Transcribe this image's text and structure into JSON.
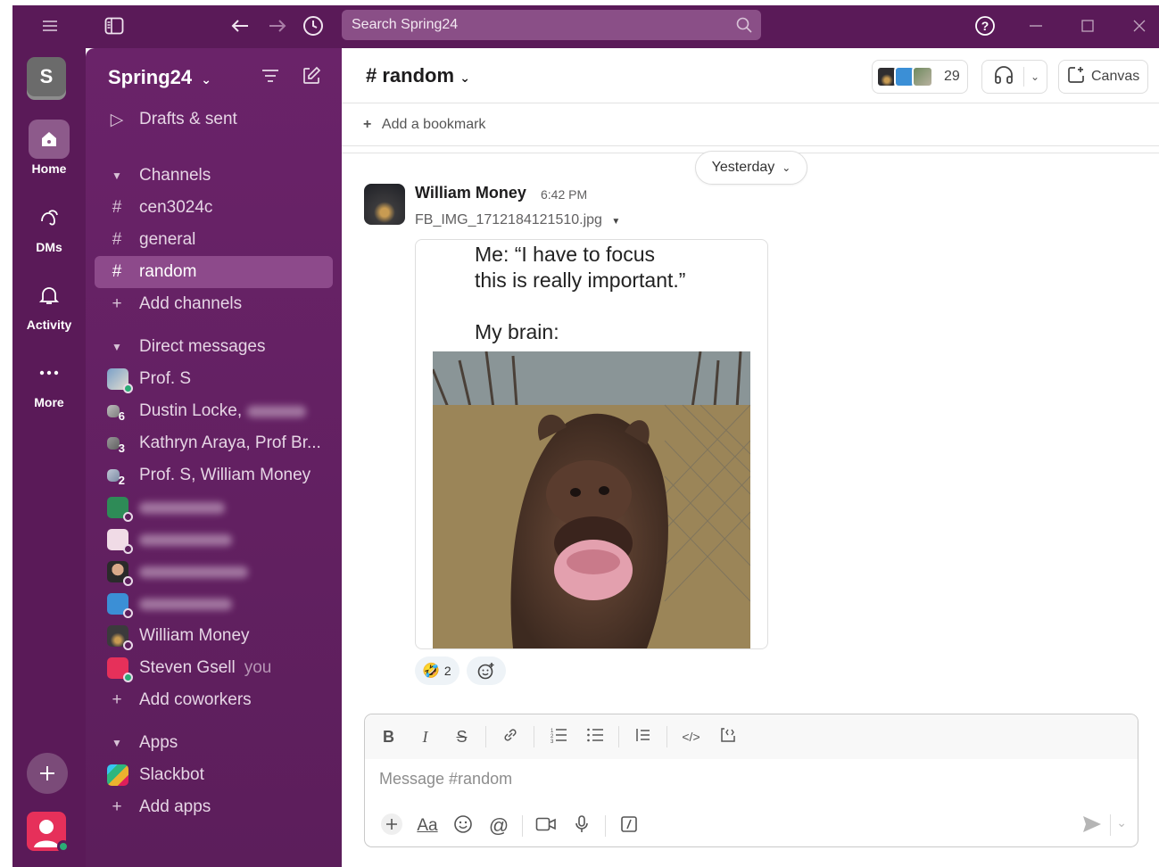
{
  "titlebar": {
    "search_placeholder": "Search Spring24"
  },
  "rail": {
    "workspace_initial": "S",
    "items": [
      {
        "label": "Home"
      },
      {
        "label": "DMs"
      },
      {
        "label": "Activity"
      },
      {
        "label": "More"
      }
    ]
  },
  "sidebar": {
    "workspace_name": "Spring24",
    "drafts_label": "Drafts & sent",
    "channels_header": "Channels",
    "channels": [
      "cen3024c",
      "general",
      "random"
    ],
    "add_channels": "Add channels",
    "dms_header": "Direct messages",
    "dms": [
      {
        "name": "Prof. S",
        "count": ""
      },
      {
        "name": "Dustin Locke,",
        "count": "6"
      },
      {
        "name": "Kathryn Araya, Prof Br...",
        "count": "3"
      },
      {
        "name": "Prof. S, William Money",
        "count": "2"
      },
      {
        "name": "William Money",
        "count": ""
      },
      {
        "name": "Steven Gsell",
        "count": "",
        "you": "you"
      }
    ],
    "add_coworkers": "Add coworkers",
    "apps_header": "Apps",
    "apps": [
      "Slackbot"
    ],
    "add_apps": "Add apps"
  },
  "channel": {
    "hash": "#",
    "name": "random",
    "member_count": "29",
    "canvas_label": "Canvas",
    "bookmark_label": "Add a bookmark"
  },
  "messages": {
    "day_divider": "Yesterday",
    "author": "William Money",
    "time": "6:42 PM",
    "file_name": "FB_IMG_1712184121510.jpg",
    "meme_lines": [
      "Me: “I have to focus",
      "this is really important.”",
      "My brain:"
    ],
    "reaction_emoji": "🤣",
    "reaction_count": "2"
  },
  "composer": {
    "placeholder": "Message #random",
    "format_buttons": [
      "bold",
      "italic",
      "strikethrough",
      "link",
      "ordered-list",
      "bulleted-list",
      "blockquote",
      "code",
      "code-block"
    ]
  },
  "colors": {
    "aubergine": "#5a1a58",
    "sidebar": "#6a2369",
    "active_item": "#8d4a8b",
    "presence": "#2bac76"
  }
}
